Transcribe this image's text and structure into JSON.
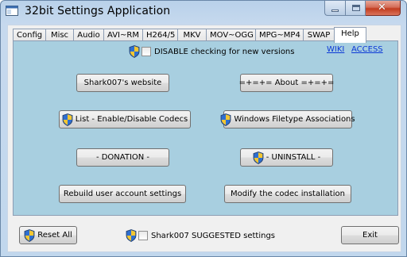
{
  "window": {
    "title": "32bit Settings Application",
    "close_glyph": "✕"
  },
  "tabs": [
    {
      "label": "Config"
    },
    {
      "label": "Misc"
    },
    {
      "label": "Audio"
    },
    {
      "label": "AVI~RM"
    },
    {
      "label": "H264/5"
    },
    {
      "label": "MKV"
    },
    {
      "label": "MOV~OGG"
    },
    {
      "label": "MPG~MP4"
    },
    {
      "label": "SWAP"
    },
    {
      "label": "Help",
      "active": true
    }
  ],
  "help": {
    "disable_check_label": "DISABLE checking for new versions",
    "disable_check_checked": false,
    "wiki_link": "WIKI",
    "access_link": "ACCESS",
    "buttons": {
      "website": "Shark007's website",
      "about": "=+=+= About =+=+=",
      "codecs": "List - Enable/Disable Codecs",
      "associations": "Windows Filetype Associations",
      "donation": "- DONATION -",
      "uninstall": "- UNINSTALL -",
      "rebuild": "Rebuild user account settings",
      "modify": "Modify the codec installation"
    }
  },
  "footer": {
    "reset_label": "Reset All",
    "suggested_label": "Shark007 SUGGESTED settings",
    "suggested_checked": false,
    "exit_label": "Exit"
  },
  "colors": {
    "panel_background": "#a8cfe0",
    "link": "#0b38d6"
  },
  "icons": {
    "shield": "uac-shield-icon",
    "app": "app-window-icon"
  }
}
